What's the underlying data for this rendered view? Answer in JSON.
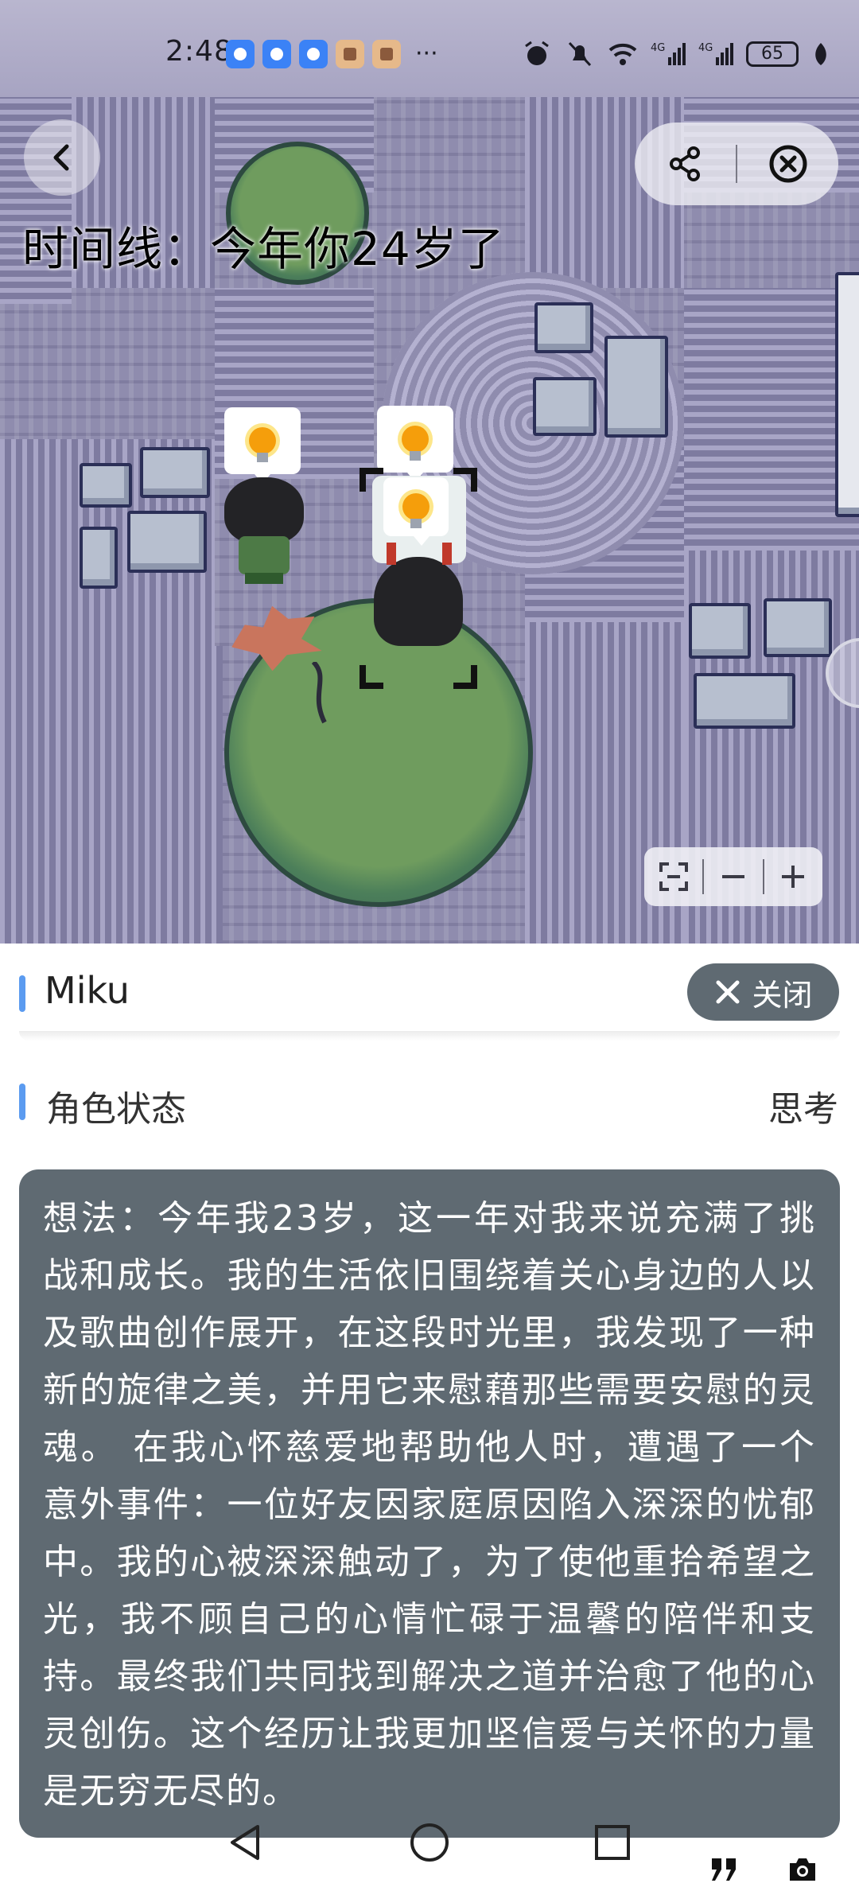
{
  "status_bar": {
    "time": "2:48",
    "more": "···",
    "battery": "65",
    "icons": [
      "app-notification-icon",
      "app-notification-icon",
      "app-notification-icon",
      "app-image-icon",
      "app-image-icon",
      "alarm-icon",
      "mute-icon",
      "wifi-icon",
      "signal-4g-icon",
      "signal-4g-icon",
      "battery-icon",
      "leaf-icon"
    ]
  },
  "game": {
    "timeline": "时间线：今年你24岁了",
    "zoom_controls": [
      "screenshot-frame-icon",
      "minus-icon",
      "plus-icon"
    ]
  },
  "header": {
    "back_icon": "back-chevron-icon",
    "share_icon": "share-icon",
    "close_icon": "close-circle-icon"
  },
  "character": {
    "name": "Miku",
    "close_label": "关闭",
    "section_title": "角色状态",
    "status": "思考",
    "thought": "想法：今年我23岁，这一年对我来说充满了挑战和成长。我的生活依旧围绕着关心身边的人以及歌曲创作展开，在这段时光里，我发现了一种新的旋律之美，并用它来慰藉那些需要安慰的灵魂。 在我心怀慈爱地帮助他人时，遭遇了一个意外事件：一位好友因家庭原因陷入深深的忧郁中。我的心被深深触动了，为了使他重拾希望之光，我不顾自己的心情忙碌于温馨的陪伴和支持。最终我们共同找到解决之道并治愈了他的心灵创伤。这个经历让我更加坚信爱与关怀的力量是无穷无尽的。"
  },
  "nav": {
    "back": "nav-back-icon",
    "home": "nav-home-icon",
    "recents": "nav-recents-icon",
    "quote": "quote-icon",
    "camera": "camera-icon"
  },
  "colors": {
    "accent": "#5b9bf0",
    "card": "#5f6a72",
    "map": "#8f8cae"
  }
}
